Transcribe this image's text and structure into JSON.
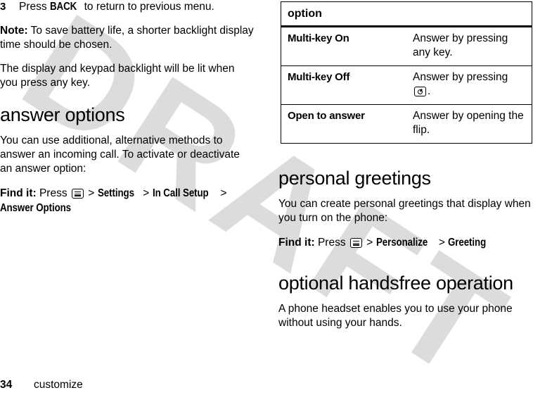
{
  "document": {
    "watermark": "DRAFT",
    "watermark_color": "#dcdcdc",
    "page_number": "34",
    "chapter": "customize"
  },
  "left_column": {
    "step": {
      "number": "3",
      "text_before": "Press ",
      "key": "BACK",
      "text_after": " to return to previous menu."
    },
    "note": {
      "label": "Note:",
      "text": " To save battery life, a shorter backlight display time should be chosen."
    },
    "paragraph": "The display and keypad backlight will be lit when you press any key.",
    "heading": "answer options",
    "intro": "You can use additional, alternative methods to answer an incoming call. To activate or deactivate an answer option:",
    "find_it": {
      "label": "Find it:",
      "press": " Press ",
      "icon": "menu-key-icon",
      "sep1": " > ",
      "item1": "Settings",
      "sep2": " > ",
      "item2": "In Call Setup",
      "sep3": " > ",
      "item3": "Answer Options"
    }
  },
  "right_column": {
    "table": {
      "header": "option",
      "rows": [
        {
          "option": "Multi-key On",
          "description": "Answer by pressing any key.",
          "icon": null,
          "description_tail": null
        },
        {
          "option": "Multi-key Off",
          "description": "Answer by pressing ",
          "icon": "send-key-icon",
          "description_tail": "."
        },
        {
          "option": "Open to answer",
          "description": "Answer by opening the flip.",
          "icon": null,
          "description_tail": null
        }
      ]
    },
    "greetings": {
      "heading": "personal greetings",
      "intro": "You can create personal greetings that display when you turn on the phone:",
      "find_it": {
        "label": "Find it:",
        "press": " Press ",
        "icon": "menu-key-icon",
        "sep1": " > ",
        "item1": "Personalize",
        "sep2": " > ",
        "item2": "Greeting"
      }
    },
    "handsfree": {
      "heading": "optional handsfree operation",
      "body": "A phone headset enables you to use your phone without using your hands."
    }
  }
}
